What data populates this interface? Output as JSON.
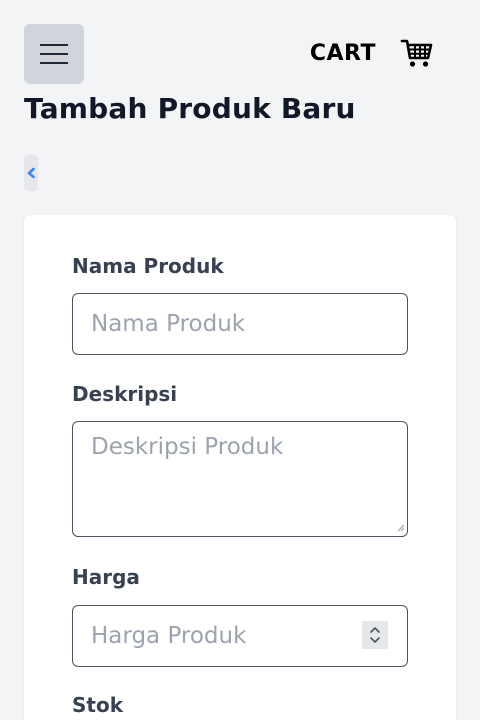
{
  "header": {
    "cart_label": "CART",
    "menu_icon": "hamburger-menu-icon",
    "cart_icon": "shopping-cart-icon"
  },
  "page": {
    "title": "Tambah Produk Baru",
    "back_icon": "chevron-left-icon"
  },
  "form": {
    "name": {
      "label": "Nama Produk",
      "placeholder": "Nama Produk",
      "value": ""
    },
    "description": {
      "label": "Deskripsi",
      "placeholder": "Deskripsi Produk",
      "value": ""
    },
    "price": {
      "label": "Harga",
      "placeholder": "Harga Produk",
      "value": ""
    },
    "stock": {
      "label": "Stok"
    }
  },
  "colors": {
    "background": "#f3f4f6",
    "card": "#ffffff",
    "accent": "#3b82f6",
    "label": "#374151"
  }
}
